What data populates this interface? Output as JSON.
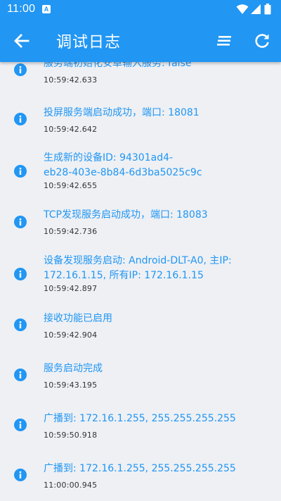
{
  "status_bar": {
    "time": "11:00",
    "notification_icon": "a-box-icon",
    "icons": [
      "wifi-icon",
      "signal-icon",
      "battery-icon"
    ]
  },
  "toolbar": {
    "title": "调试日志",
    "back_icon": "arrow-left-icon",
    "clear_icon": "clear-list-icon",
    "refresh_icon": "refresh-icon"
  },
  "colors": {
    "primary": "#2196f3",
    "background": "#eef0f4",
    "message_text": "#2196f3",
    "time_text": "#333333"
  },
  "logs": [
    {
      "level_icon": "info-icon",
      "message": "服务端初始化安卓输入服务: false",
      "time": "10:59:42.633"
    },
    {
      "level_icon": "info-icon",
      "message": "投屏服务端启动成功，端口: 18081",
      "time": "10:59:42.642"
    },
    {
      "level_icon": "info-icon",
      "message": "生成新的设备ID: 94301ad4-\neb28-403e-8b84-6d3ba5025c9c",
      "time": "10:59:42.655"
    },
    {
      "level_icon": "info-icon",
      "message": "TCP发现服务启动成功，端口: 18083",
      "time": "10:59:42.736"
    },
    {
      "level_icon": "info-icon",
      "message": "设备发现服务启动: Android-DLT-A0, 主IP:\n172.16.1.15, 所有IP: 172.16.1.15",
      "time": "10:59:42.897"
    },
    {
      "level_icon": "info-icon",
      "message": "接收功能已启用",
      "time": "10:59:42.904"
    },
    {
      "level_icon": "info-icon",
      "message": "服务启动完成",
      "time": "10:59:43.195"
    },
    {
      "level_icon": "info-icon",
      "message": "广播到: 172.16.1.255, 255.255.255.255",
      "time": "10:59:50.918"
    },
    {
      "level_icon": "info-icon",
      "message": "广播到: 172.16.1.255, 255.255.255.255",
      "time": "11:00:00.945"
    }
  ]
}
